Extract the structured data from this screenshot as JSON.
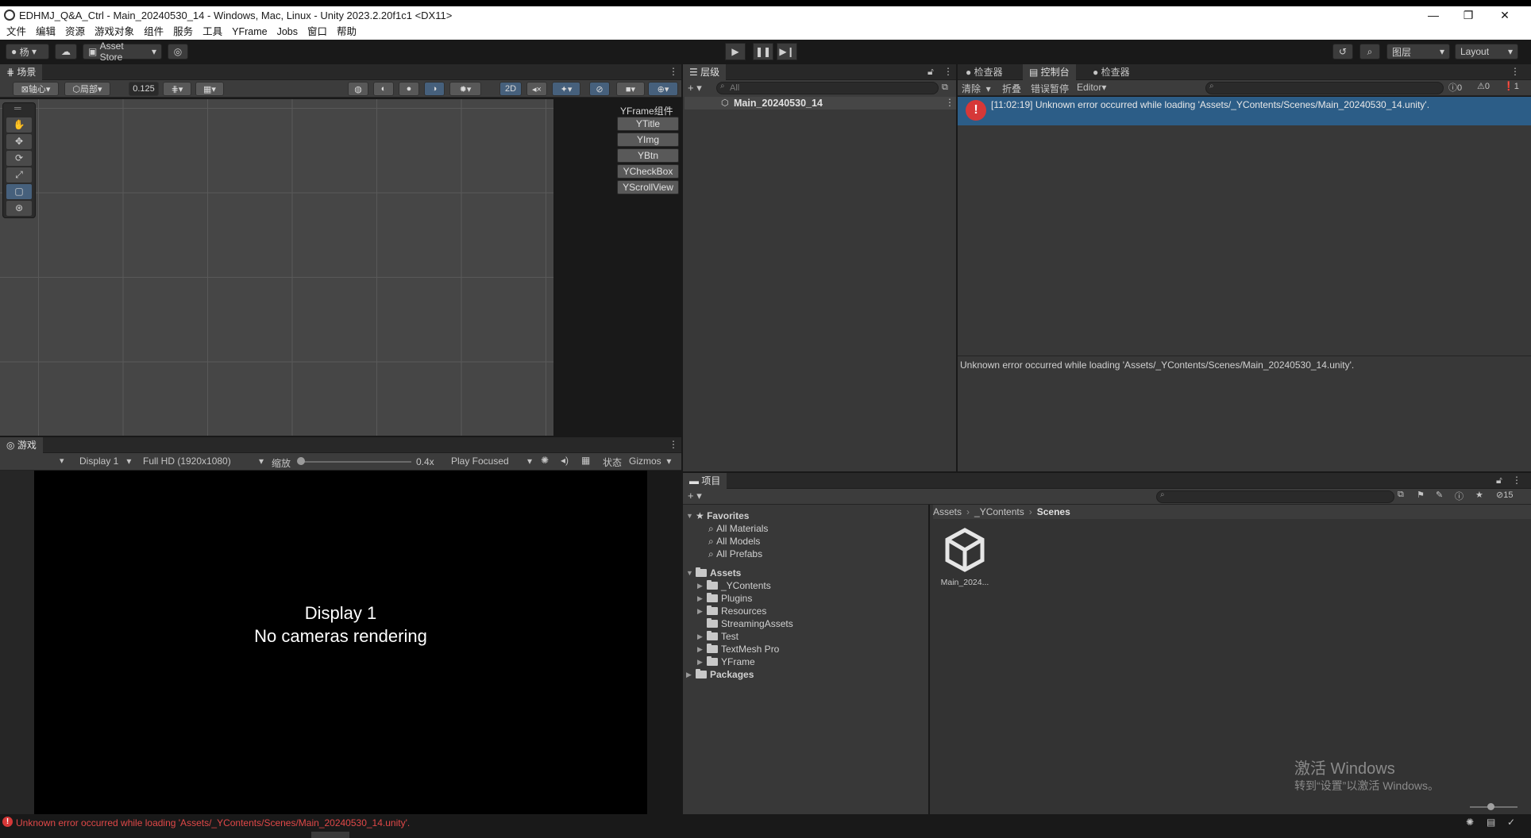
{
  "window": {
    "title": "EDHMJ_Q&A_Ctrl - Main_20240530_14 - Windows, Mac, Linux - Unity 2023.2.20f1c1 <DX11>",
    "minimize": "—",
    "maximize": "❐",
    "close": "✕"
  },
  "menu": [
    "文件",
    "编辑",
    "资源",
    "游戏对象",
    "组件",
    "服务",
    "工具",
    "YFrame",
    "Jobs",
    "窗口",
    "帮助"
  ],
  "toolbar": {
    "account": "杨",
    "asset_store": "Asset Store",
    "layers": "图层",
    "layout": "Layout"
  },
  "scene": {
    "tab": "场景",
    "pivot": "轴心",
    "local": "局部",
    "snap_value": "0.125",
    "mode_2d": "2D",
    "yframe_title": "YFrame组件",
    "yframe_buttons": [
      "YTitle",
      "YImg",
      "YBtn",
      "YCheckBox",
      "YScrollView"
    ]
  },
  "game": {
    "tab": "游戏",
    "display": "Display 1",
    "resolution": "Full HD (1920x1080)",
    "scale_label": "缩放",
    "scale_value": "0.4x",
    "scale_fraction": 0.0,
    "play_mode": "Play Focused",
    "stats": "状态",
    "gizmos": "Gizmos",
    "message_line1": "Display 1",
    "message_line2": "No cameras rendering"
  },
  "hierarchy": {
    "tab": "层级",
    "search_placeholder": "All",
    "scene_name": "Main_20240530_14"
  },
  "console": {
    "tabs": [
      "检查器",
      "控制台",
      "检查器"
    ],
    "clear": "清除",
    "collapse": "折叠",
    "error_pause": "错误暂停",
    "editor": "Editor",
    "log_count": "0",
    "warn_count": "0",
    "error_count": "1",
    "entry": "[11:02:19] Unknown error occurred while loading 'Assets/_YContents/Scenes/Main_20240530_14.unity'.",
    "detail": "Unknown error occurred while loading 'Assets/_YContents/Scenes/Main_20240530_14.unity'."
  },
  "project": {
    "tab": "项目",
    "hidden_count": "15",
    "favorites_label": "Favorites",
    "favorites": [
      "All Materials",
      "All Models",
      "All Prefabs"
    ],
    "assets_label": "Assets",
    "folders": [
      "_YContents",
      "Plugins",
      "Resources",
      "StreamingAssets",
      "Test",
      "TextMesh Pro",
      "YFrame"
    ],
    "packages_label": "Packages",
    "breadcrumb": [
      "Assets",
      "_YContents",
      "Scenes"
    ],
    "asset_file": "Main_2024..."
  },
  "status": {
    "message": "Unknown error occurred while loading 'Assets/_YContents/Scenes/Main_20240530_14.unity'."
  },
  "watermark": {
    "line1": "激活 Windows",
    "line2": "转到“设置”以激活 Windows。"
  }
}
